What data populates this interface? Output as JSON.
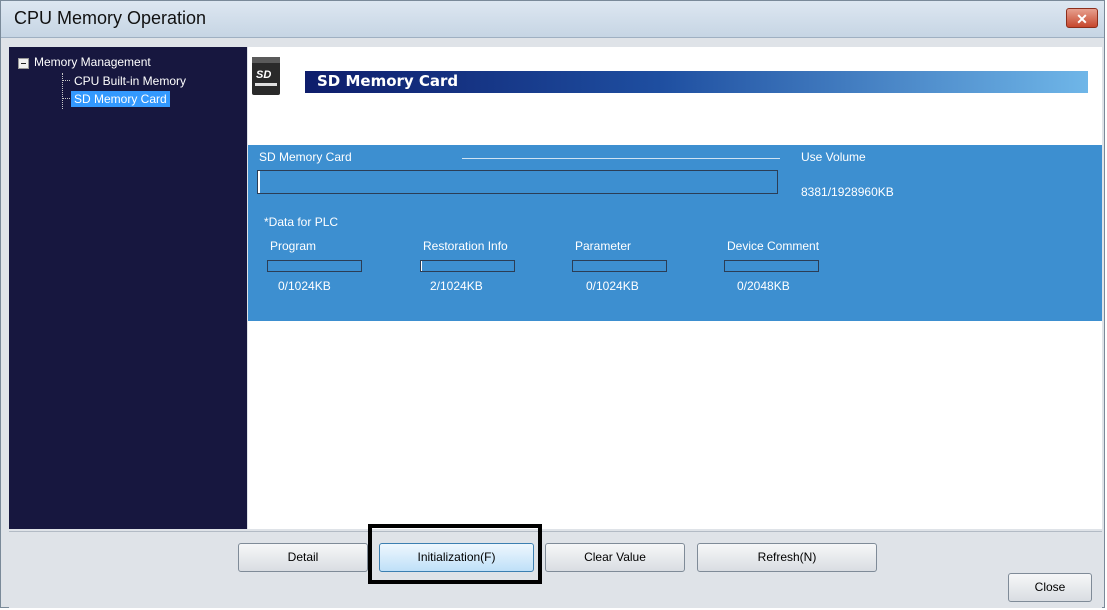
{
  "window": {
    "title": "CPU Memory Operation",
    "close_icon": "close-x-icon"
  },
  "tree": {
    "root_label": "Memory Management",
    "items": [
      {
        "label": "CPU Built-in Memory",
        "selected": false
      },
      {
        "label": "SD Memory Card",
        "selected": true
      }
    ]
  },
  "panel": {
    "icon": "sd-card-icon",
    "icon_text": "SD",
    "title": "SD Memory Card",
    "section_label": "SD Memory Card",
    "use_volume_label": "Use Volume",
    "use_volume_value": "8381/1928960KB",
    "use_volume_fraction": 0.0043,
    "data_for_plc_label": "*Data for PLC",
    "categories": [
      {
        "label": "Program",
        "value": "0/1024KB",
        "fraction": 0.0
      },
      {
        "label": "Restoration Info",
        "value": "2/1024KB",
        "fraction": 0.002
      },
      {
        "label": "Parameter",
        "value": "0/1024KB",
        "fraction": 0.0
      },
      {
        "label": "Device Comment",
        "value": "0/2048KB",
        "fraction": 0.0
      }
    ]
  },
  "buttons": {
    "detail": "Detail",
    "initialization": "Initialization(F)",
    "clear_value": "Clear Value",
    "refresh": "Refresh(N)",
    "close": "Close"
  },
  "colors": {
    "sidebar_bg": "#17173f",
    "panel_blue": "#3d8fd0",
    "selection": "#3399ff",
    "header_dark": "#0e1d6b",
    "header_light": "#6fb6e8"
  }
}
